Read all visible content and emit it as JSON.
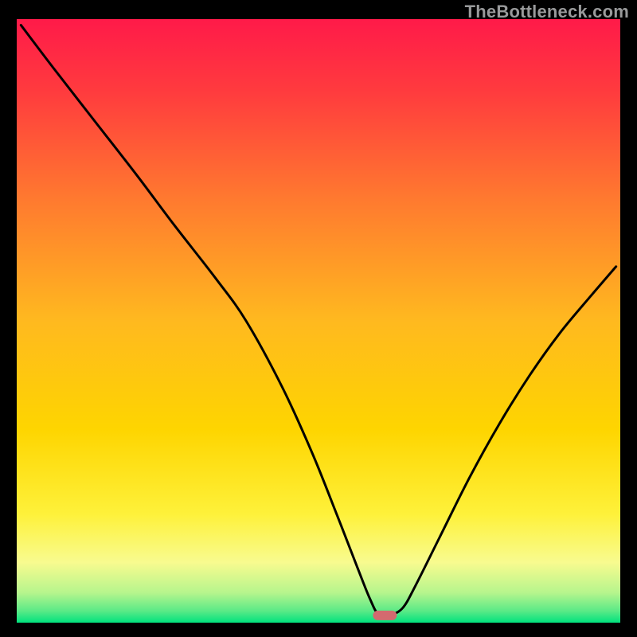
{
  "watermark": "TheBottleneck.com",
  "chart_data": {
    "type": "line",
    "title": "",
    "xlabel": "",
    "ylabel": "",
    "xlim": [
      0,
      100
    ],
    "ylim": [
      0,
      100
    ],
    "grid": false,
    "curve_note": "V-shaped bottleneck curve; y≈0 is optimal, higher is worse. Minimum near x≈61.",
    "x": [
      0.7,
      6,
      13,
      20,
      26,
      33,
      38,
      44,
      49,
      53,
      56.5,
      58.5,
      60,
      62,
      64,
      66,
      70,
      75,
      80,
      85,
      90,
      95,
      99.3
    ],
    "y": [
      99,
      92,
      83,
      74,
      66,
      57,
      50,
      39,
      28,
      18,
      9,
      4,
      1.3,
      1.3,
      2.5,
      6,
      14,
      24,
      33,
      41,
      48,
      54,
      59
    ],
    "optimal_marker": {
      "x": 61,
      "y": 1.2,
      "color": "#d36a6f",
      "shape": "pill"
    },
    "background_gradient": {
      "top_color": "#ff1a49",
      "mid_color": "#fed500",
      "bottom_colors": [
        "#f8fb8f",
        "#b7f58d",
        "#00e27e"
      ]
    }
  }
}
